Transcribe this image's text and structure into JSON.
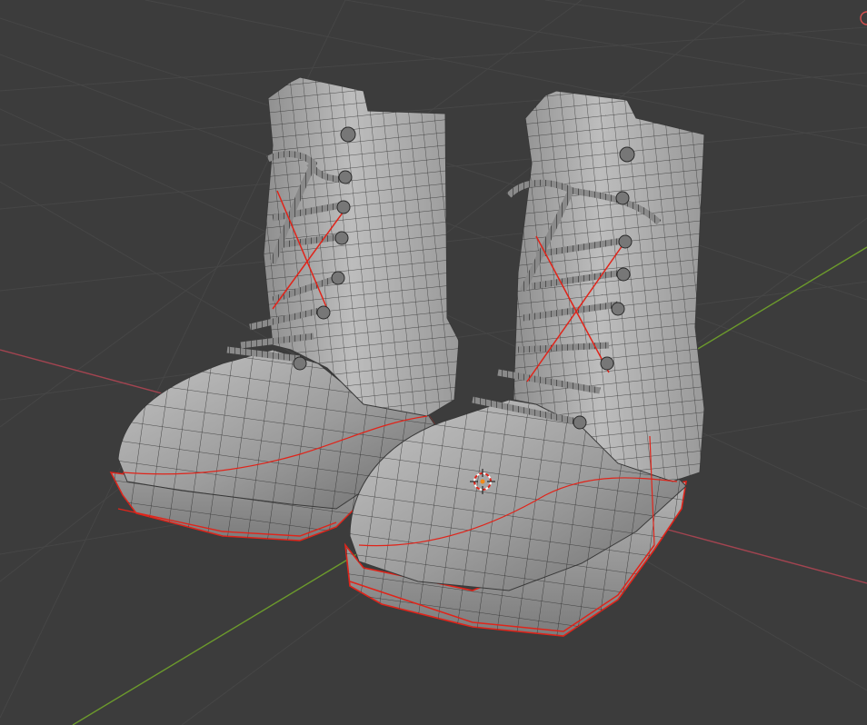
{
  "viewport": {
    "background": "#3c3c3c",
    "grid_color": "#4a4a4a",
    "x_axis_color": "#a24450",
    "y_axis_color": "#6c9a2c",
    "mesh_fill": "#9a9a9a",
    "wire_color": "#2a2a2a",
    "seam_color": "#e0241a",
    "object": "boots",
    "icons": [
      "3d-cursor-icon",
      "navigation-gizmo-icon"
    ]
  }
}
